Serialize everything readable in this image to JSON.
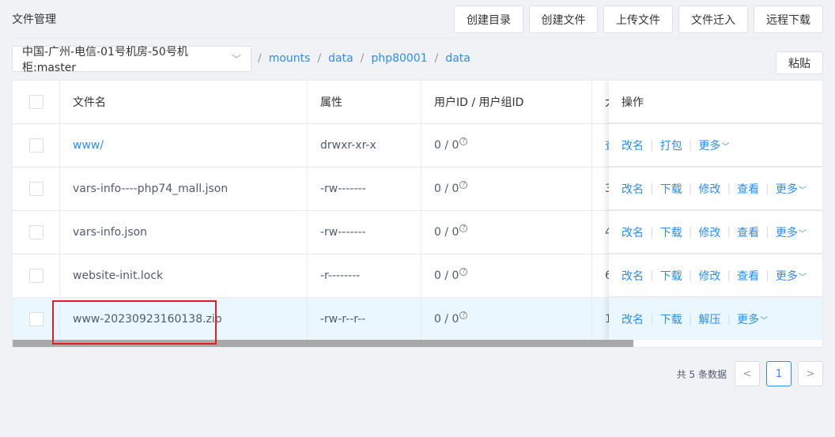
{
  "page": {
    "title": "文件管理"
  },
  "toolbar": {
    "create_dir": "创建目录",
    "create_file": "创建文件",
    "upload_file": "上传文件",
    "move_in": "文件迁入",
    "remote_download": "远程下载",
    "paste": "粘贴"
  },
  "location": {
    "server": "中国-广州-电信-01号机房-50号机柜:master",
    "path": [
      "mounts",
      "data",
      "php80001",
      "data"
    ]
  },
  "table": {
    "headers": {
      "name": "文件名",
      "attr": "属性",
      "uid": "用户ID / 用户组ID",
      "size": "大",
      "ops": "操作"
    },
    "rows": [
      {
        "name": "www/",
        "attr": "drwxr-xr-x",
        "uid": "0 / 0",
        "size": "查",
        "is_dir": true,
        "ops": [
          "改名",
          "打包",
          "更多"
        ]
      },
      {
        "name": "vars-info----php74_mall.json",
        "attr": "-rw-------",
        "uid": "0 / 0",
        "size": "3",
        "is_dir": false,
        "ops": [
          "改名",
          "下载",
          "修改",
          "查看",
          "更多"
        ]
      },
      {
        "name": "vars-info.json",
        "attr": "-rw-------",
        "uid": "0 / 0",
        "size": "4",
        "is_dir": false,
        "ops": [
          "改名",
          "下载",
          "修改",
          "查看",
          "更多"
        ]
      },
      {
        "name": "website-init.lock",
        "attr": "-r--------",
        "uid": "0 / 0",
        "size": "6",
        "is_dir": false,
        "ops": [
          "改名",
          "下载",
          "修改",
          "查看",
          "更多"
        ]
      },
      {
        "name": "www-20230923160138.zip",
        "attr": "-rw-r--r--",
        "uid": "0 / 0",
        "size": "1",
        "is_dir": false,
        "ops": [
          "改名",
          "下载",
          "解压",
          "更多"
        ]
      }
    ]
  },
  "pagination": {
    "total": "共 5 条数据",
    "current": "1",
    "prev": "<",
    "next": ">"
  },
  "colors": {
    "accent": "#2d8cf0",
    "highlight": "#e02020",
    "selected_row": "#ebf7ff"
  }
}
